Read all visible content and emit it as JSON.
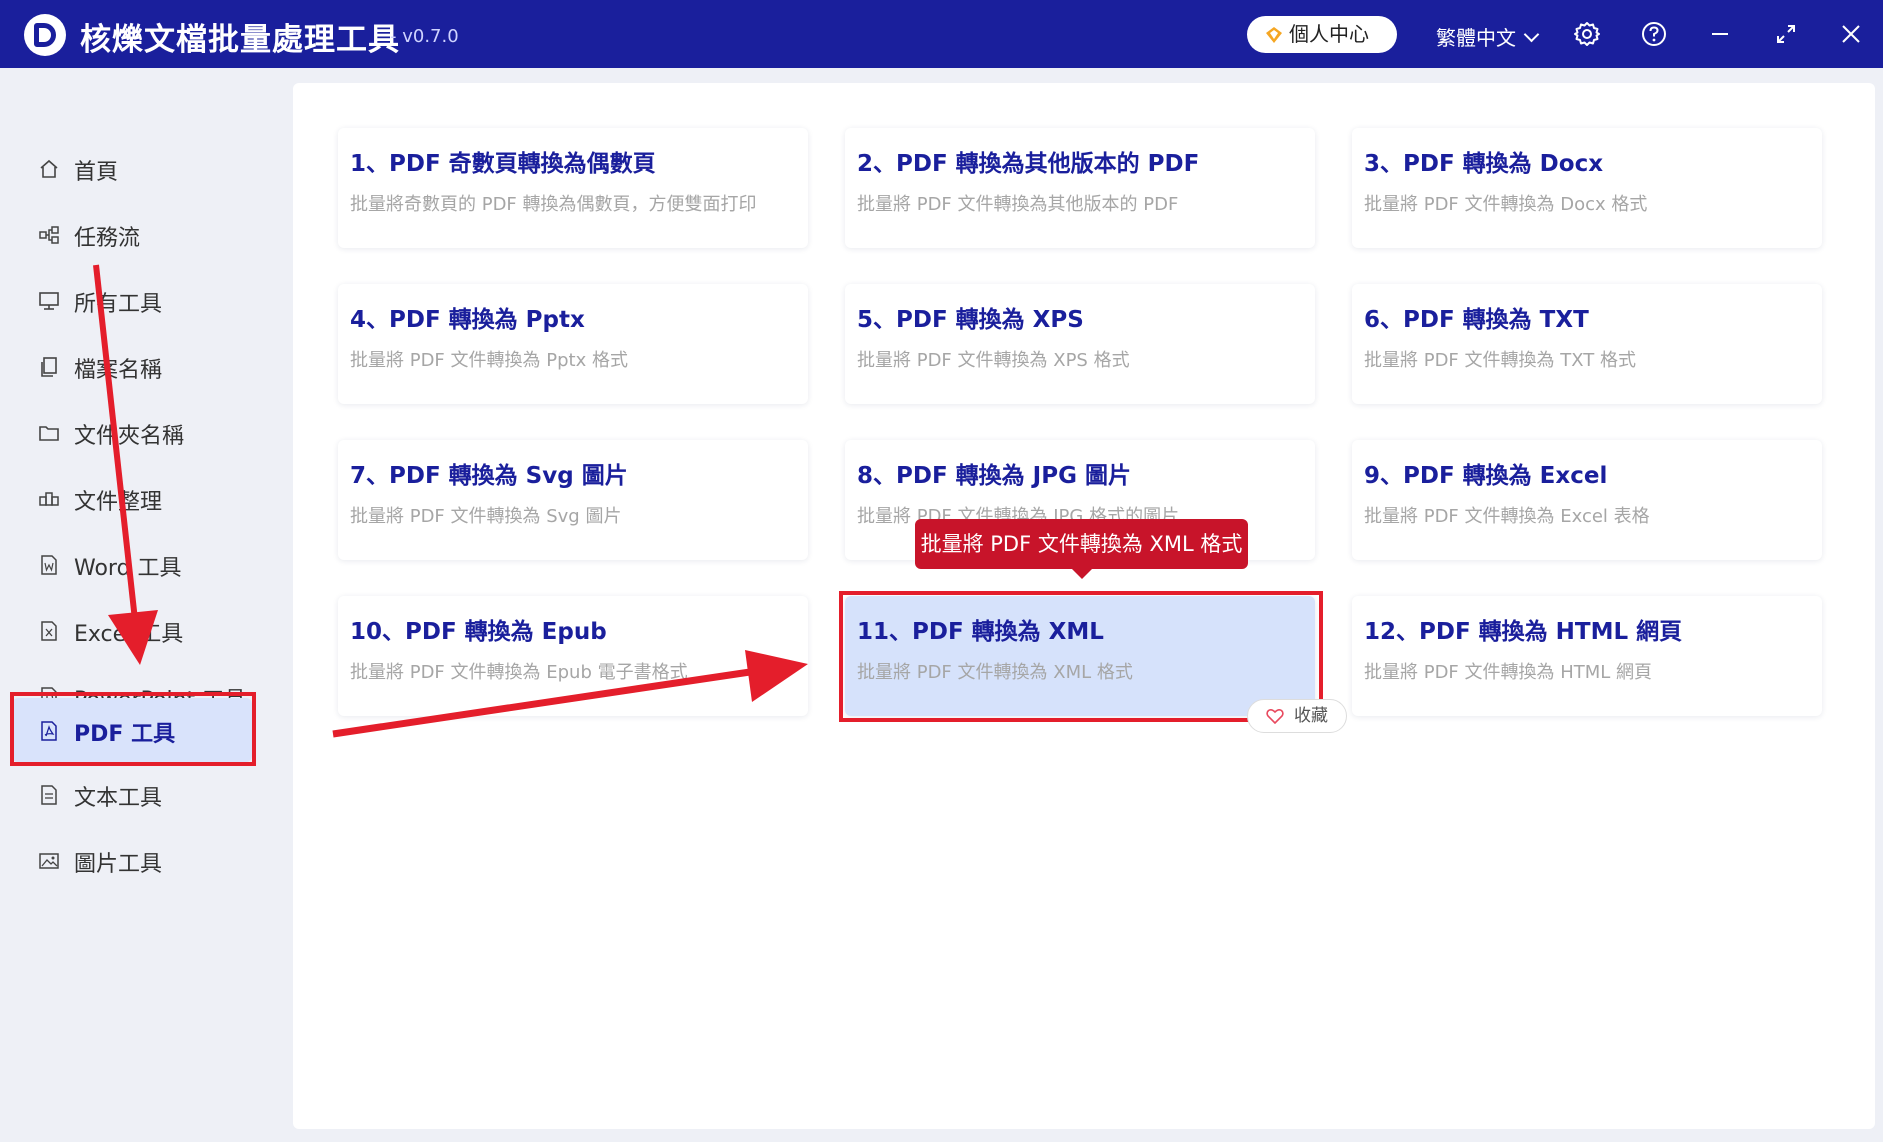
{
  "app": {
    "title": "核爍文檔批量處理工具",
    "version": "- v0.7.0",
    "brand_color": "#1a1f9c"
  },
  "titlebar": {
    "user_center": "個人中心",
    "language": "繁體中文",
    "icons": [
      "settings-icon",
      "help-icon",
      "minimize-icon",
      "maximize-icon",
      "close-icon"
    ]
  },
  "sidebar": {
    "items": [
      {
        "label": "首頁",
        "icon": "home-icon"
      },
      {
        "label": "任務流",
        "icon": "workflow-icon"
      },
      {
        "label": "所有工具",
        "icon": "monitor-icon"
      },
      {
        "label": "檔案名稱",
        "icon": "files-icon"
      },
      {
        "label": "文件夾名稱",
        "icon": "folder-icon"
      },
      {
        "label": "文件整理",
        "icon": "organize-icon"
      },
      {
        "label": "Word 工具",
        "icon": "word-icon"
      },
      {
        "label": "Excel 工具",
        "icon": "excel-icon"
      },
      {
        "label": "PowerPoint 工具",
        "icon": "powerpoint-icon"
      },
      {
        "label": "PDF 工具",
        "icon": "pdf-icon",
        "active": true
      },
      {
        "label": "文本工具",
        "icon": "text-icon"
      },
      {
        "label": "圖片工具",
        "icon": "image-icon"
      }
    ]
  },
  "tools": [
    {
      "title": "1、PDF 奇數頁轉換為偶數頁",
      "desc": "批量將奇數頁的 PDF 轉換為偶數頁，方便雙面打印"
    },
    {
      "title": "2、PDF 轉換為其他版本的 PDF",
      "desc": "批量將 PDF 文件轉換為其他版本的 PDF"
    },
    {
      "title": "3、PDF 轉換為 Docx",
      "desc": "批量將 PDF 文件轉換為 Docx 格式"
    },
    {
      "title": "4、PDF 轉換為 Pptx",
      "desc": "批量將 PDF 文件轉換為 Pptx 格式"
    },
    {
      "title": "5、PDF 轉換為 XPS",
      "desc": "批量將 PDF 文件轉換為 XPS 格式"
    },
    {
      "title": "6、PDF 轉換為 TXT",
      "desc": "批量將 PDF 文件轉換為 TXT 格式"
    },
    {
      "title": "7、PDF 轉換為 Svg 圖片",
      "desc": "批量將 PDF 文件轉換為 Svg 圖片"
    },
    {
      "title": "8、PDF 轉換為 JPG 圖片",
      "desc": "批量將 PDF 文件轉換為 JPG 格式的圖片"
    },
    {
      "title": "9、PDF 轉換為 Excel",
      "desc": "批量將 PDF 文件轉換為 Excel 表格"
    },
    {
      "title": "10、PDF 轉換為 Epub",
      "desc": "批量將 PDF 文件轉換為 Epub 電子書格式"
    },
    {
      "title": "11、PDF 轉換為 XML",
      "desc": "批量將 PDF 文件轉換為 XML 格式",
      "highlighted": true
    },
    {
      "title": "12、PDF 轉換為 HTML 網頁",
      "desc": "批量將 PDF 文件轉換為 HTML 網頁"
    }
  ],
  "tooltip": "批量將 PDF 文件轉換為 XML 格式",
  "favorite_label": "收藏",
  "annotation_color": "#e41e2b"
}
